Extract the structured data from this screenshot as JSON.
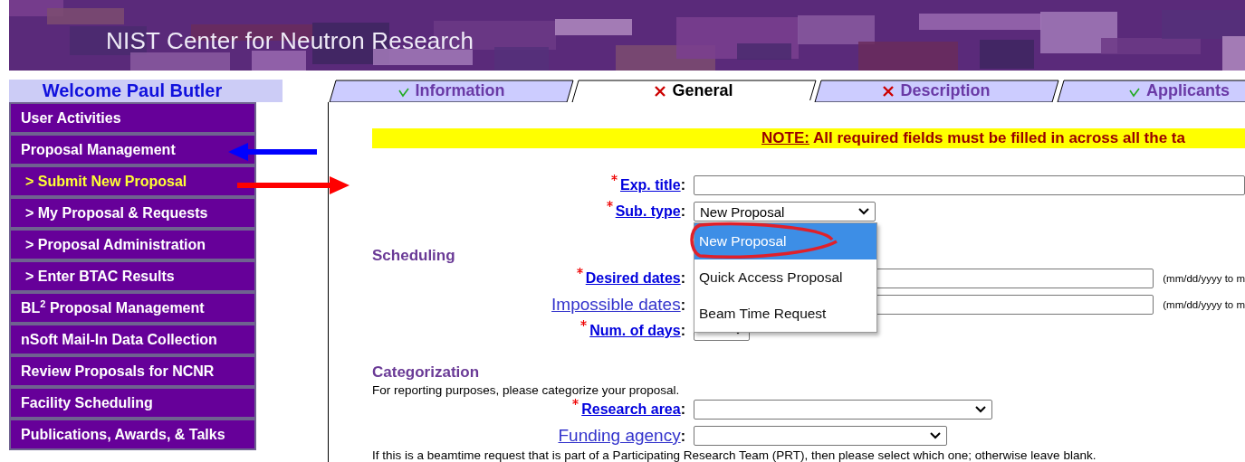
{
  "header": {
    "title": "NIST Center for Neutron Research"
  },
  "sidebar": {
    "welcome": "Welcome Paul Butler",
    "items": [
      {
        "label": "User Activities",
        "kind": "section",
        "selected": false
      },
      {
        "label": "Proposal Management",
        "kind": "section",
        "selected": false
      },
      {
        "label": "> Submit New Proposal",
        "kind": "sub",
        "selected": true
      },
      {
        "label": "> My Proposal & Requests",
        "kind": "sub",
        "selected": false
      },
      {
        "label": "> Proposal Administration",
        "kind": "sub",
        "selected": false
      },
      {
        "label": "> Enter BTAC Results",
        "kind": "sub",
        "selected": false
      },
      {
        "label": "BL$^{2}$ Proposal Management",
        "kind": "section",
        "selected": false
      },
      {
        "label": "nSoft Mail-In Data Collection",
        "kind": "section",
        "selected": false
      },
      {
        "label": "Review Proposals for NCNR",
        "kind": "section",
        "selected": false
      },
      {
        "label": "Facility Scheduling",
        "kind": "section",
        "selected": false
      },
      {
        "label": "Publications, Awards, & Talks",
        "kind": "section",
        "selected": false
      }
    ]
  },
  "tabs": [
    {
      "label": "Information",
      "complete": true,
      "selected": false
    },
    {
      "label": "General",
      "complete": false,
      "selected": true
    },
    {
      "label": "Description",
      "complete": false,
      "selected": false
    },
    {
      "label": "Applicants",
      "complete": true,
      "selected": false
    }
  ],
  "note": {
    "lead": "NOTE:",
    "text": "All required fields must be filled in across all the ta"
  },
  "fields": [
    {
      "label": "Exp. title",
      "separator": ":",
      "required": true,
      "kind": "text"
    },
    {
      "label": "Sub. type",
      "separator": ":",
      "required": true,
      "kind": "select",
      "value": "New Proposal",
      "expanded": true,
      "options": [
        {
          "label": "New Proposal",
          "selected": true
        },
        {
          "label": "Quick Access Proposal",
          "selected": false
        },
        {
          "label": "Beam Time Request",
          "selected": false
        }
      ]
    }
  ],
  "sections": [
    {
      "title": "Scheduling",
      "fields": [
        {
          "label": "Desired dates",
          "separator": ":",
          "required": true,
          "kind": "text",
          "hint": "(mm/dd/yyyy to m"
        },
        {
          "label": "Impossible dates",
          "separator": ":",
          "required": false,
          "kind": "text",
          "hint": "(mm/dd/yyyy to m"
        },
        {
          "label": "Num. of days",
          "separator": ":",
          "required": true,
          "kind": "select"
        }
      ]
    },
    {
      "title": "Categorization",
      "description": "For reporting purposes, please categorize your proposal.",
      "fields": [
        {
          "label": "Research area",
          "separator": ":",
          "required": true,
          "kind": "select"
        },
        {
          "label": "Funding agency",
          "separator": ":",
          "required": false,
          "kind": "select"
        }
      ],
      "footnote": "If this is a beamtime request that is part of a Participating Research Team (PRT), then please select which one; otherwise leave blank."
    }
  ],
  "annotations": [
    {
      "kind": "arrow-left",
      "color": "#0000ff"
    },
    {
      "kind": "arrow-right",
      "color": "#ff0000"
    },
    {
      "kind": "circle",
      "color": "#e0202a"
    }
  ]
}
